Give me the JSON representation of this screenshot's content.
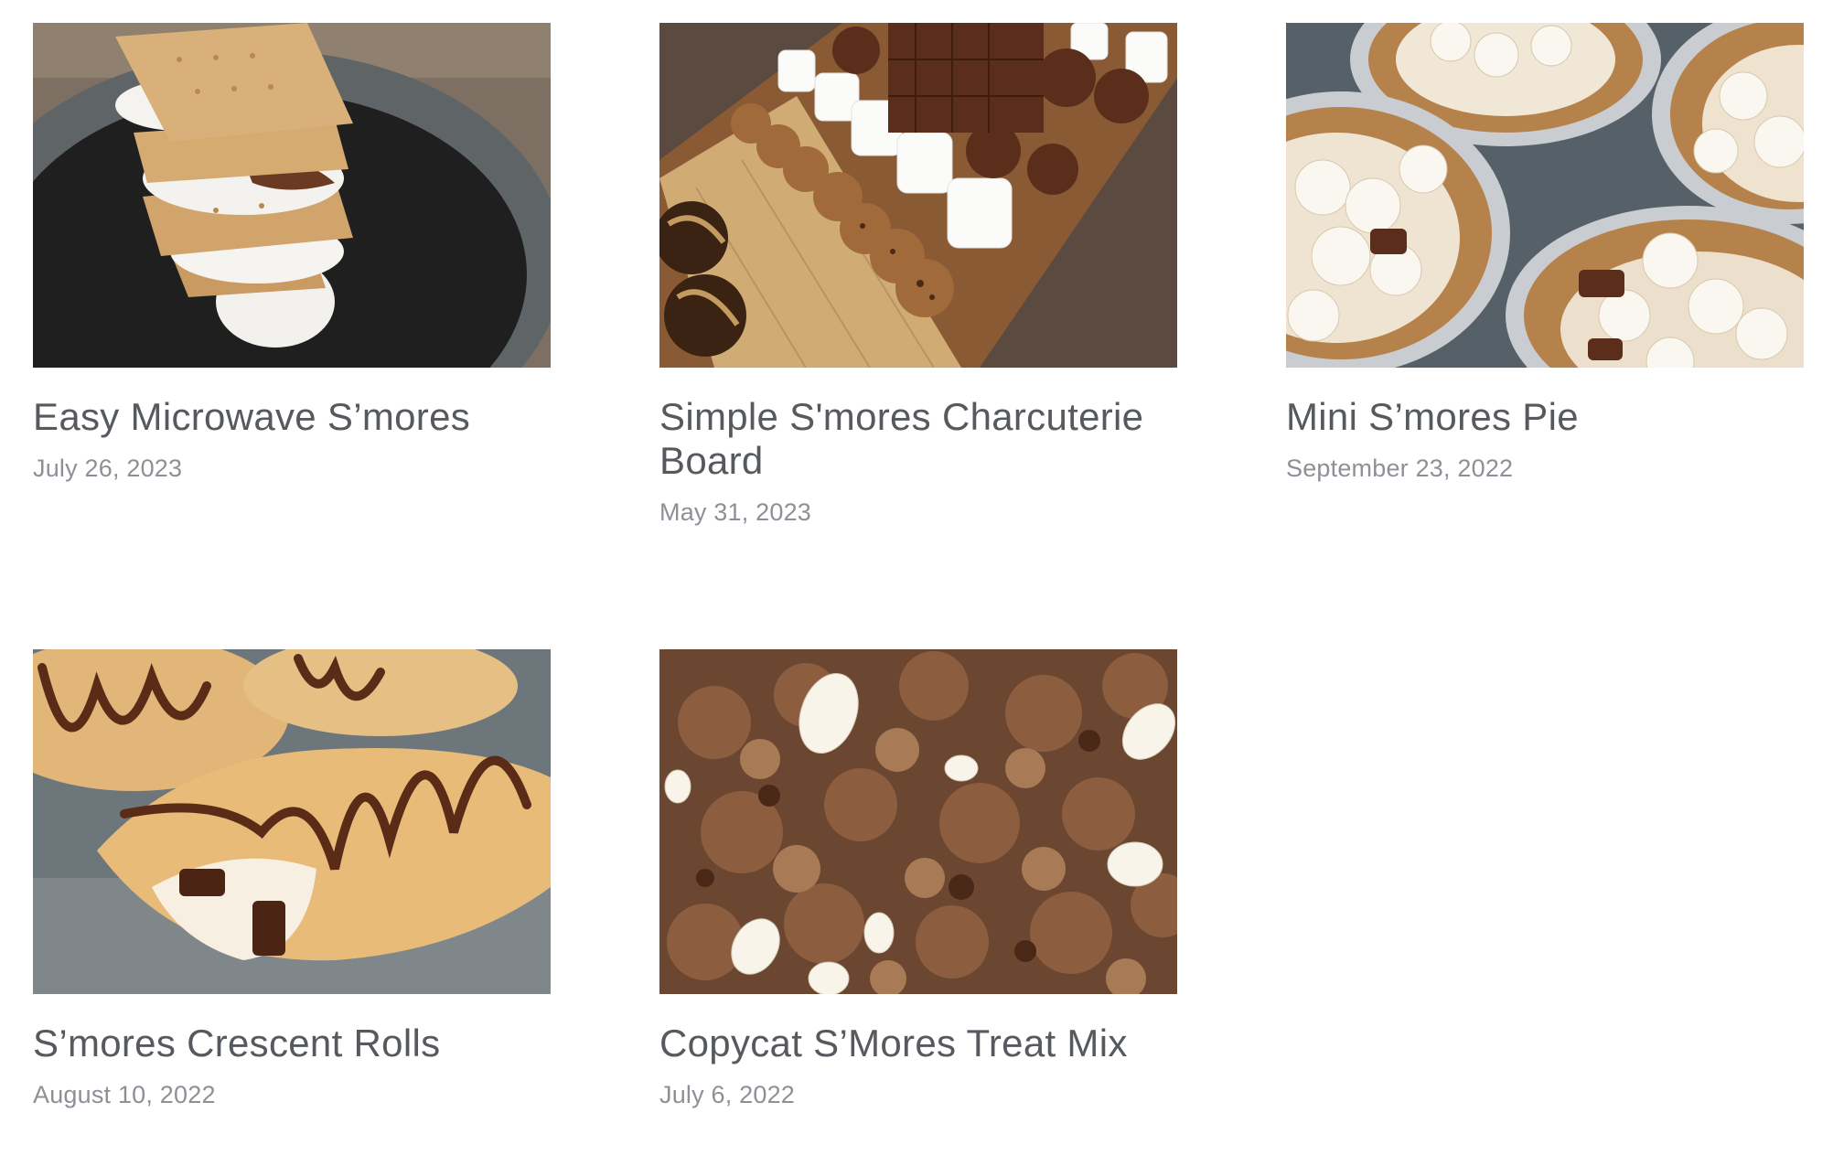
{
  "posts": [
    {
      "title": "Easy Microwave S’mores",
      "date": "July 26, 2023",
      "image": "stacked-smores-on-black-plate"
    },
    {
      "title": "Simple S'mores Charcuterie Board",
      "date": "May 31, 2023",
      "image": "smores-charcuterie-board"
    },
    {
      "title": "Mini S’mores Pie",
      "date": "September 23, 2022",
      "image": "mini-smores-pies-in-tins"
    },
    {
      "title": "S’mores Crescent Rolls",
      "date": "August 10, 2022",
      "image": "smores-crescent-rolls-chocolate-drizzle"
    },
    {
      "title": "Copycat S’Mores Treat Mix",
      "date": "July 6, 2022",
      "image": "chocolate-marshmallow-snack-mix"
    }
  ]
}
